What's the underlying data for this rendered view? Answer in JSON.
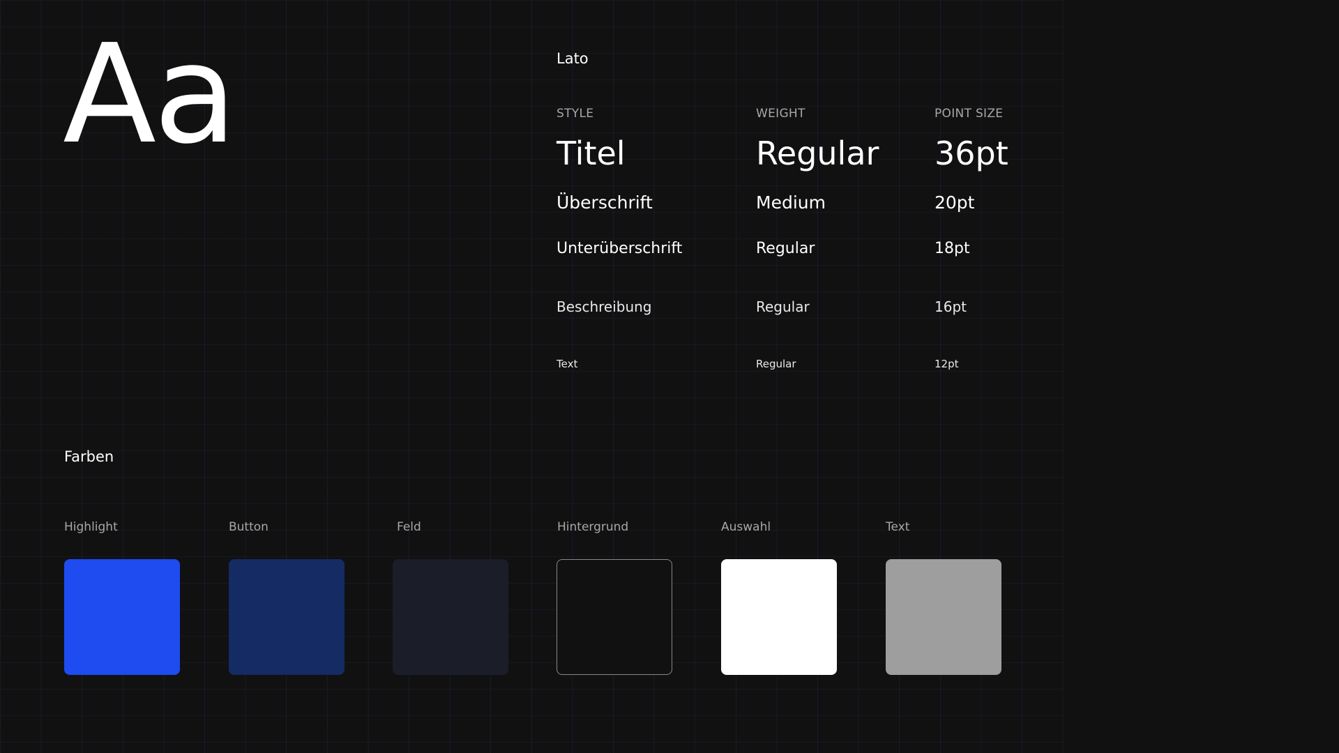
{
  "typography": {
    "sample": "Aa",
    "font_name": "Lato",
    "headers": {
      "style": "STYLE",
      "weight": "WEIGHT",
      "size": "POINT SIZE"
    },
    "rows": [
      {
        "style": "Titel",
        "weight": "Regular",
        "size": "36pt"
      },
      {
        "style": "Überschrift",
        "weight": "Medium",
        "size": "20pt"
      },
      {
        "style": "Unterüberschrift",
        "weight": "Regular",
        "size": "18pt"
      },
      {
        "style": "Beschreibung",
        "weight": "Regular",
        "size": "16pt"
      },
      {
        "style": "Text",
        "weight": "Regular",
        "size": "12pt"
      }
    ]
  },
  "colors": {
    "title": "Farben",
    "swatches": [
      {
        "label": "Highlight",
        "color": "#1e4cf0"
      },
      {
        "label": "Button",
        "color": "#152b63"
      },
      {
        "label": "Feld",
        "color": "#1b1e29"
      },
      {
        "label": "Hintergrund",
        "color": "#111111"
      },
      {
        "label": "Auswahl",
        "color": "#ffffff"
      },
      {
        "label": "Text",
        "color": "#9e9e9e"
      }
    ]
  }
}
